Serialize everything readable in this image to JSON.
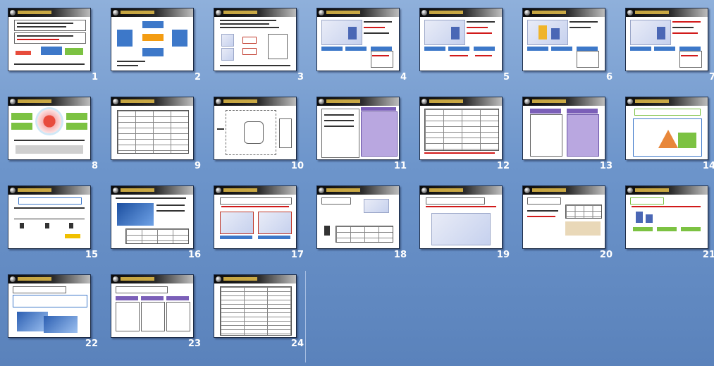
{
  "view": "slide-sorter",
  "slides": [
    {
      "number": "1"
    },
    {
      "number": "2"
    },
    {
      "number": "3"
    },
    {
      "number": "4"
    },
    {
      "number": "5"
    },
    {
      "number": "6"
    },
    {
      "number": "7"
    },
    {
      "number": "8"
    },
    {
      "number": "9"
    },
    {
      "number": "10"
    },
    {
      "number": "11"
    },
    {
      "number": "12"
    },
    {
      "number": "13"
    },
    {
      "number": "14"
    },
    {
      "number": "15"
    },
    {
      "number": "16"
    },
    {
      "number": "17"
    },
    {
      "number": "18"
    },
    {
      "number": "19"
    },
    {
      "number": "20"
    },
    {
      "number": "21"
    },
    {
      "number": "22"
    },
    {
      "number": "23"
    },
    {
      "number": "24"
    }
  ],
  "colors": {
    "background": "#6d95cb",
    "thumb_header": "#111111",
    "accent_blue": "#3d78c9",
    "accent_purple": "#7b5fb8",
    "accent_green": "#7cc242",
    "accent_red": "#d11a1a"
  }
}
